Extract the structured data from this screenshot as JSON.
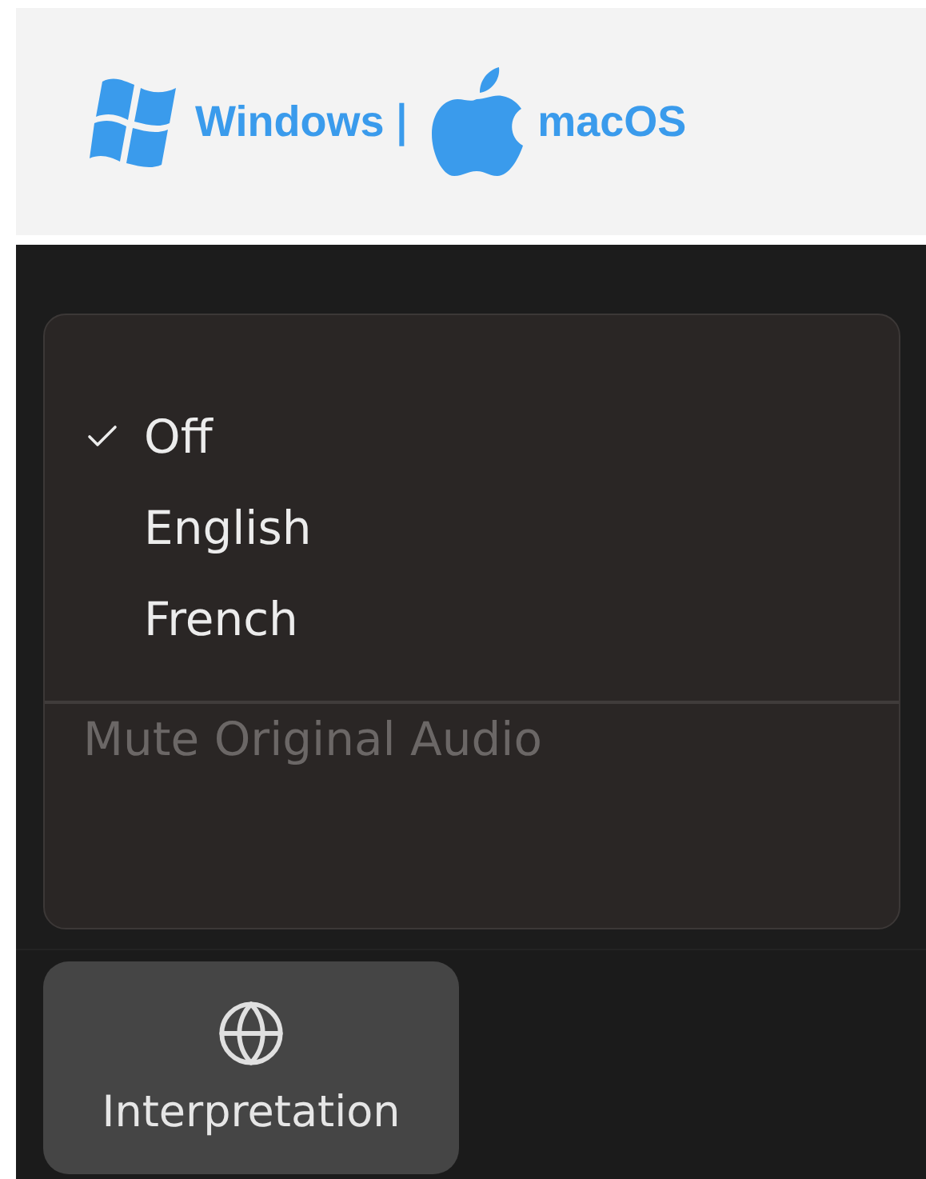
{
  "header": {
    "platforms": [
      {
        "kind": "windows",
        "label": "Windows"
      },
      {
        "kind": "apple",
        "label": "macOS"
      }
    ],
    "separator": "|"
  },
  "menu": {
    "items": [
      {
        "kind": "option",
        "label": "Off",
        "selected": true
      },
      {
        "kind": "option",
        "label": "English",
        "selected": false
      },
      {
        "kind": "option",
        "label": "French",
        "selected": false
      },
      {
        "kind": "divider"
      },
      {
        "kind": "action",
        "label": "Mute Original Audio",
        "disabled": true
      }
    ]
  },
  "toolbar": {
    "buttons": [
      {
        "kind": "globe",
        "label": "Interpretation"
      }
    ]
  }
}
